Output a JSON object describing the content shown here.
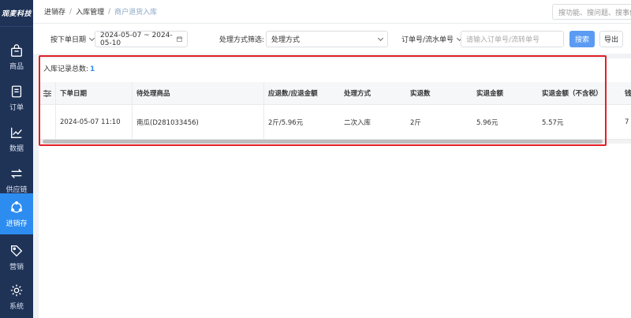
{
  "app": {
    "logo_text": "观麦科技"
  },
  "sidebar": {
    "items": [
      {
        "label": "商品",
        "icon": "shopping-bag-icon"
      },
      {
        "label": "订单",
        "icon": "document-icon"
      },
      {
        "label": "数据",
        "icon": "line-chart-icon"
      },
      {
        "label": "供应链",
        "icon": "exchange-arrows-icon"
      },
      {
        "label": "进销存",
        "icon": "inventory-cycle-icon",
        "active": true
      },
      {
        "label": "营销",
        "icon": "tag-icon"
      },
      {
        "label": "系统",
        "icon": "gear-icon"
      }
    ]
  },
  "header": {
    "breadcrumb": [
      "进销存",
      "入库管理",
      "商户退货入库"
    ],
    "search_placeholder": "搜功能、搜问题、搜事件"
  },
  "filters": {
    "date_type_label": "按下单日期",
    "date_range": "2024-05-07 ~ 2024-05-10",
    "method_label": "处理方式筛选:",
    "method_select": "处理方式",
    "order_type_label": "订单号/流水单号",
    "order_input_placeholder": "请输入订单号/流转单号",
    "search_button": "搜索",
    "export_button": "导出"
  },
  "records": {
    "count_label": "入库记录总数:",
    "count_value": "1"
  },
  "table": {
    "columns": [
      "下单日期",
      "待处理商品",
      "应退数/应退金额",
      "处理方式",
      "实退数",
      "实退金额",
      "实退金额（不含税）",
      "钱"
    ],
    "rows": [
      [
        "2024-05-07 11:10",
        "南瓜(D281033456)",
        "2斤/5.96元",
        "二次入库",
        "2斤",
        "5.96元",
        "5.57元",
        "7"
      ]
    ]
  },
  "colors": {
    "sidebar_bg": "#1f3357",
    "active_nav": "#2d8cf0",
    "primary": "#5b9cf2",
    "highlight_border": "#e21f26"
  }
}
